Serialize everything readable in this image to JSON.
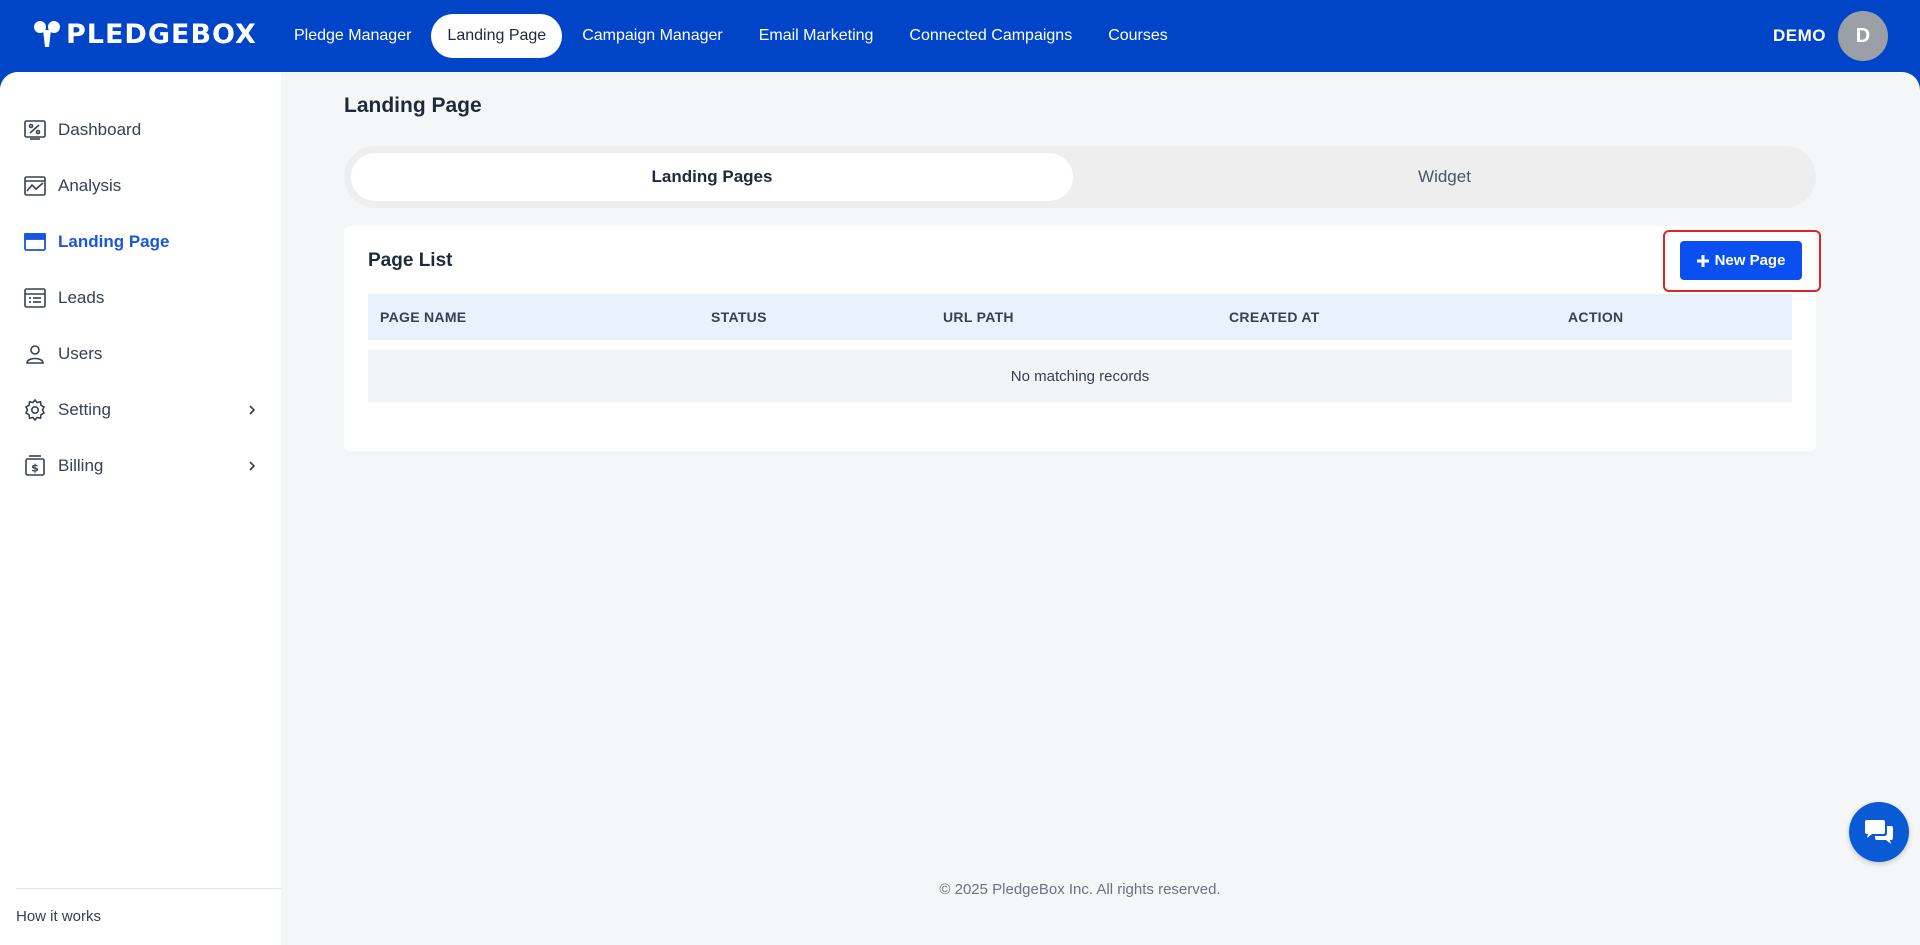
{
  "brand": {
    "name": "PLEDGEBOX"
  },
  "nav": {
    "items": [
      {
        "label": "Pledge Manager"
      },
      {
        "label": "Landing Page"
      },
      {
        "label": "Campaign Manager"
      },
      {
        "label": "Email Marketing"
      },
      {
        "label": "Connected Campaigns"
      },
      {
        "label": "Courses"
      }
    ],
    "active": "Landing Page"
  },
  "user": {
    "name": "DEMO",
    "initial": "D"
  },
  "sidebar": {
    "items": [
      {
        "label": "Dashboard",
        "icon": "dashboard-icon"
      },
      {
        "label": "Analysis",
        "icon": "analysis-icon"
      },
      {
        "label": "Landing Page",
        "icon": "landing-page-icon"
      },
      {
        "label": "Leads",
        "icon": "leads-icon"
      },
      {
        "label": "Users",
        "icon": "user-icon"
      },
      {
        "label": "Setting",
        "icon": "gear-icon"
      },
      {
        "label": "Billing",
        "icon": "billing-icon"
      }
    ],
    "active": "Landing Page",
    "footer_link": "How it works"
  },
  "main": {
    "title": "Landing Page",
    "tabs": [
      {
        "label": "Landing Pages"
      },
      {
        "label": "Widget"
      }
    ],
    "active_tab": "Landing Pages",
    "card": {
      "title": "Page List",
      "new_button": "New Page",
      "columns": [
        "PAGE NAME",
        "STATUS",
        "URL PATH",
        "CREATED AT",
        "ACTION"
      ],
      "empty_text": "No matching records"
    }
  },
  "footer": {
    "copyright": "© 2025 PledgeBox Inc. All rights reserved."
  },
  "colors": {
    "brand": "#0044c8",
    "accent": "#0a4ff0",
    "highlight": "#dc2626"
  }
}
